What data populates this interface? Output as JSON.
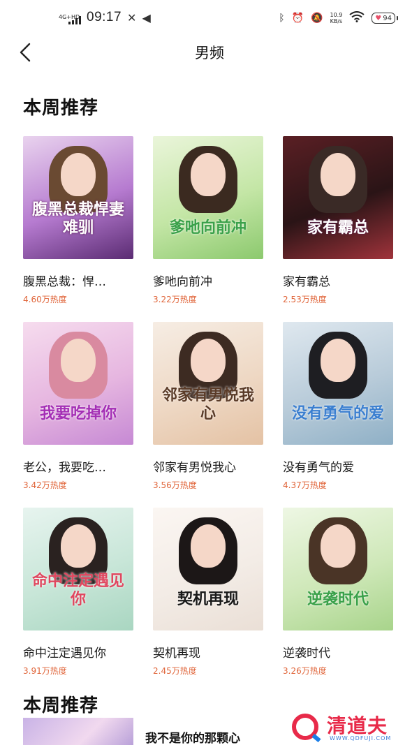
{
  "status_bar": {
    "network": "4G+HD",
    "time": "09:17",
    "speed_value": "10.9",
    "speed_unit": "KB/s",
    "battery": "94",
    "icons": [
      "tools-icon",
      "mute-icon",
      "bluetooth-icon",
      "alarm-icon",
      "no-notify-icon",
      "wifi-icon"
    ]
  },
  "nav": {
    "title": "男频"
  },
  "section1": {
    "title": "本周推荐"
  },
  "books": [
    {
      "title": "腹黑总裁：悍…",
      "heat": "4.60万热度",
      "cover_title": "腹黑总裁悍妻难驯",
      "cover_colors": [
        "#e9d3ee",
        "#b67bd0",
        "#5b2c73"
      ],
      "hair": "#6a4a32",
      "text_color": "#ffffff"
    },
    {
      "title": "爹吔向前冲",
      "heat": "3.22万热度",
      "cover_title": "爹吔向前冲",
      "cover_colors": [
        "#eaf5da",
        "#c4e6a6",
        "#8cc96e"
      ],
      "hair": "#3b2a20",
      "text_color": "#3aa14a"
    },
    {
      "title": "家有霸总",
      "heat": "2.53万热度",
      "cover_title": "家有霸总",
      "cover_colors": [
        "#5a1f24",
        "#2a1416",
        "#a0333b"
      ],
      "hair": "#3a2a26",
      "text_color": "#ffffff"
    },
    {
      "title": "老公，我要吃…",
      "heat": "3.42万热度",
      "cover_title": "我要吃掉你",
      "cover_colors": [
        "#f6dcee",
        "#e6b6e0",
        "#c689d4"
      ],
      "hair": "#d98aa0",
      "text_color": "#a42fb5"
    },
    {
      "title": "邻家有男悦我心",
      "heat": "3.56万热度",
      "cover_title": "邻家有男悦我心",
      "cover_colors": [
        "#f6ede4",
        "#eed8c4",
        "#e4c2a4"
      ],
      "hair": "#3d2b22",
      "text_color": "#5a3b28"
    },
    {
      "title": "没有勇气的爱",
      "heat": "4.37万热度",
      "cover_title": "没有勇气的爱",
      "cover_colors": [
        "#dfe8ef",
        "#b8cbd9",
        "#8fb0c6"
      ],
      "hair": "#1e1e22",
      "text_color": "#3b7fd0"
    },
    {
      "title": "命中注定遇见你",
      "heat": "3.91万热度",
      "cover_title": "命中注定遇见你",
      "cover_colors": [
        "#e7f4ef",
        "#c8e6d8",
        "#a9d6c1"
      ],
      "hair": "#2a2220",
      "text_color": "#e0475f"
    },
    {
      "title": "契机再现",
      "heat": "2.45万热度",
      "cover_title": "契机再现",
      "cover_colors": [
        "#fbf6f2",
        "#f3ece6",
        "#eadfd6"
      ],
      "hair": "#1c1717",
      "text_color": "#1a1a1a"
    },
    {
      "title": "逆袭时代",
      "heat": "3.26万热度",
      "cover_title": "逆袭时代",
      "cover_colors": [
        "#eef7e4",
        "#cfe8b9",
        "#a8d48b"
      ],
      "hair": "#4a3426",
      "text_color": "#3aa14a"
    }
  ],
  "section2": {
    "title": "本周推荐",
    "peek_book_title": "我不是你的那颗心"
  },
  "watermark": {
    "name": "清道夫",
    "url": "WWW.QDFUJI.COM"
  }
}
